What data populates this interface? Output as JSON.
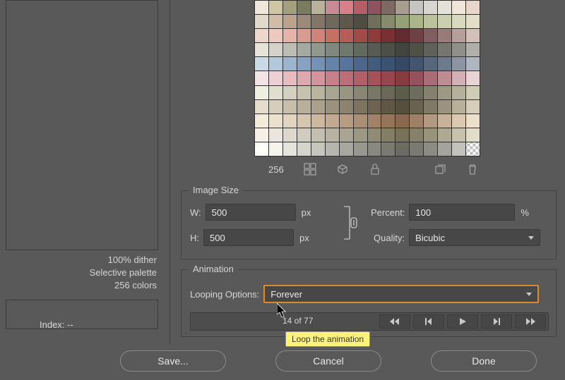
{
  "palette": {
    "count": "256",
    "swatches": [
      "#f0e7db",
      "#cfc6a3",
      "#a2a17b",
      "#7b7c5c",
      "#b8b29a",
      "#c98a96",
      "#d87f88",
      "#b55e66",
      "#8f535f",
      "#7d6a64",
      "#a89e8e",
      "#c6c5c2",
      "#d7d6d1",
      "#e4e1d8",
      "#efe6d9",
      "#e7d6c9",
      "#e1daca",
      "#d0bca7",
      "#bba28c",
      "#9b8a77",
      "#837668",
      "#70695b",
      "#5d584b",
      "#4f4c42",
      "#6f6f5a",
      "#858b6c",
      "#96a077",
      "#aab489",
      "#bcc29d",
      "#cbcfaf",
      "#d9d9c0",
      "#e2dec7",
      "#efd6cc",
      "#ecc8bf",
      "#e4b4a8",
      "#d99a8f",
      "#d08479",
      "#c56f65",
      "#b55d56",
      "#a24b46",
      "#8d3c3b",
      "#773133",
      "#632a30",
      "#6e4245",
      "#815e5f",
      "#987c7a",
      "#b59f9a",
      "#d1c0b9",
      "#e7e3db",
      "#d4d2c9",
      "#bcbdb5",
      "#a6a9a1",
      "#93988f",
      "#81887e",
      "#71786e",
      "#63695f",
      "#575b53",
      "#4c4f48",
      "#42443f",
      "#4f5148",
      "#60615a",
      "#76766f",
      "#909089",
      "#b0afa9",
      "#c9d9e6",
      "#b3c7dc",
      "#9bb4d0",
      "#87a3c4",
      "#7492b6",
      "#6483a8",
      "#56759a",
      "#4b688c",
      "#425c7e",
      "#3b5270",
      "#354864",
      "#44566f",
      "#56677c",
      "#6c7a8b",
      "#8b94a0",
      "#b0b6c0",
      "#f4e3e6",
      "#eed0d4",
      "#e6bcc1",
      "#dda8af",
      "#d3949c",
      "#c9808a",
      "#be6e78",
      "#b35f69",
      "#a6525a",
      "#97464d",
      "#863b41",
      "#95525c",
      "#a86e77",
      "#bd8d93",
      "#d3b0b4",
      "#e8d3d5",
      "#efeee3",
      "#e0dfce",
      "#d3d1bd",
      "#c5c3ae",
      "#b7b59e",
      "#a8a690",
      "#989681",
      "#898773",
      "#797765",
      "#6a6958",
      "#5c5b4c",
      "#6e6c5d",
      "#84826f",
      "#9b9984",
      "#b3b09b",
      "#cfccb5",
      "#e5dccc",
      "#d7cdbb",
      "#c8beab",
      "#b9af9b",
      "#aaa08c",
      "#9b917d",
      "#8c826e",
      "#7d735f",
      "#6e6451",
      "#605747",
      "#564e3e",
      "#6a6251",
      "#817967",
      "#9b937f",
      "#b8b09b",
      "#d6ceb8",
      "#f3ecda",
      "#ece1cd",
      "#e2d4be",
      "#d7c6ae",
      "#cdb89f",
      "#c2aa90",
      "#b79c82",
      "#ac8e74",
      "#a18167",
      "#96745b",
      "#8a6850",
      "#9e8067",
      "#b3997f",
      "#c7b198",
      "#dbc9b1",
      "#ede0ca",
      "#f5f0e7",
      "#eae6dd",
      "#ded9ce",
      "#d1ccbf",
      "#c4bfb0",
      "#b7b2a1",
      "#aaa592",
      "#9d9883",
      "#908b74",
      "#837e66",
      "#767158",
      "#86816a",
      "#98937c",
      "#aea994",
      "#c7c2ad",
      "#e2ddc8",
      "#fffffa",
      "#f4f4ed",
      "#e5e5de",
      "#d5d5ce",
      "#c6c6bf",
      "#b6b6af",
      "#a7a7a0",
      "#989891",
      "#898982",
      "#7a7a73",
      "#6b6b64",
      "#7a7a73",
      "#8c8c85",
      "#a4a49d",
      "#c3c3bc",
      "#ffffff"
    ]
  },
  "summary": {
    "dither": "100% dither",
    "palette": "Selective palette",
    "colors": "256 colors"
  },
  "index_label": "Index:",
  "index_value": "--",
  "image_size": {
    "label": "Image Size",
    "w_label": "W:",
    "w_value": "500",
    "w_unit": "px",
    "h_label": "H:",
    "h_value": "500",
    "h_unit": "px",
    "percent_label": "Percent:",
    "percent_value": "100",
    "percent_unit": "%",
    "quality_label": "Quality:",
    "quality_value": "Bicubic"
  },
  "animation": {
    "label": "Animation",
    "looping_label": "Looping Options:",
    "looping_value": "Forever",
    "frame_text": "14 of 77"
  },
  "tooltip": "Loop the animation",
  "buttons": {
    "save": "Save...",
    "cancel": "Cancel",
    "done": "Done"
  }
}
